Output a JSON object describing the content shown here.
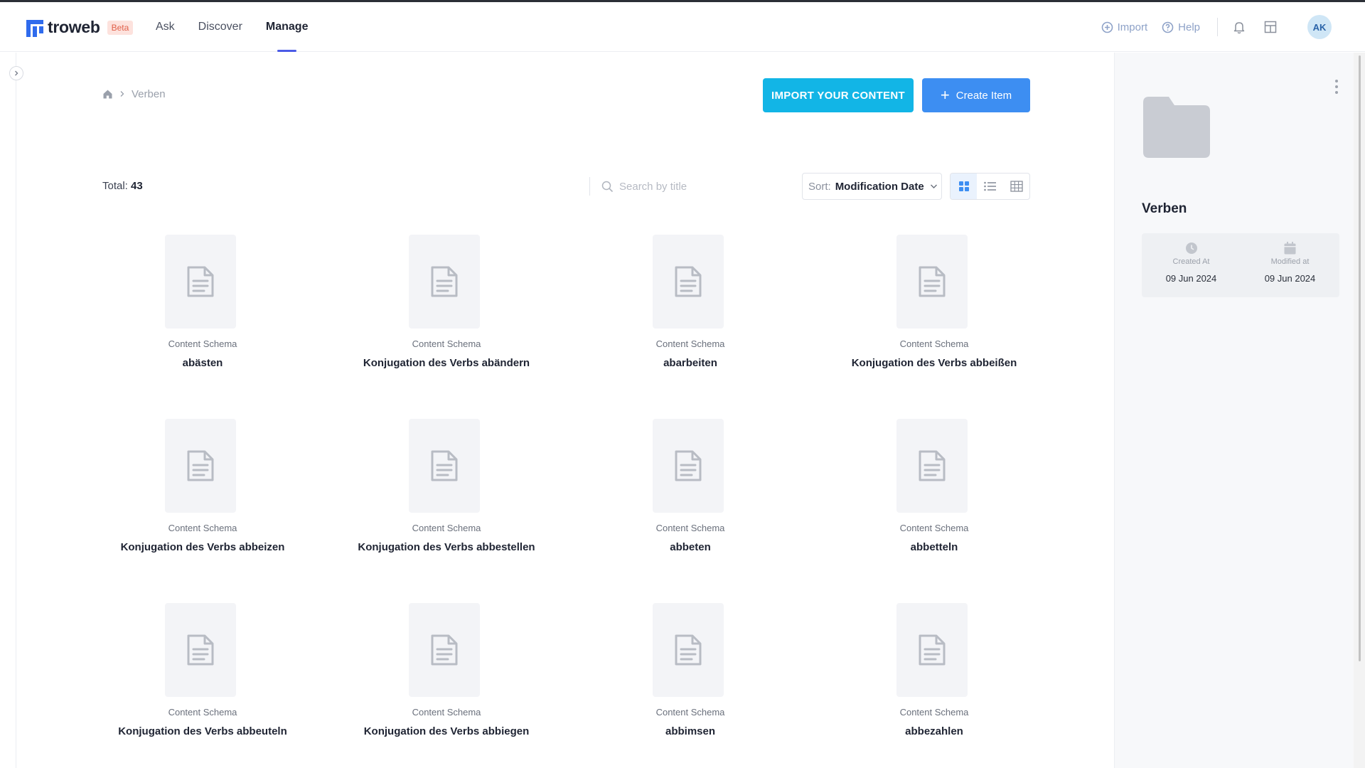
{
  "app": {
    "logo_text": "troweb",
    "badge": "Beta"
  },
  "nav": {
    "items": [
      {
        "label": "Ask"
      },
      {
        "label": "Discover"
      },
      {
        "label": "Manage",
        "active": true
      }
    ]
  },
  "header": {
    "import_label": "Import",
    "help_label": "Help",
    "avatar_initials": "AK",
    "icons": [
      "import-icon",
      "help-icon",
      "bell-icon",
      "layout-icon"
    ]
  },
  "breadcrumb": {
    "home_icon": "home-icon",
    "current": "Verben"
  },
  "actions": {
    "import_content": "IMPORT YOUR CONTENT",
    "create_item": "Create Item"
  },
  "toolbar": {
    "total_label": "Total:",
    "total_value": "43",
    "search_placeholder": "Search by title",
    "sort_label": "Sort:",
    "sort_value": "Modification Date",
    "active_view": "grid"
  },
  "items": [
    {
      "type": "Content Schema",
      "title": "abästen"
    },
    {
      "type": "Content Schema",
      "title": "Konjugation des Verbs abändern"
    },
    {
      "type": "Content Schema",
      "title": "abarbeiten"
    },
    {
      "type": "Content Schema",
      "title": "Konjugation des Verbs abbeißen"
    },
    {
      "type": "Content Schema",
      "title": "Konjugation des Verbs abbeizen"
    },
    {
      "type": "Content Schema",
      "title": "Konjugation des Verbs abbestellen"
    },
    {
      "type": "Content Schema",
      "title": "abbeten"
    },
    {
      "type": "Content Schema",
      "title": "abbetteln"
    },
    {
      "type": "Content Schema",
      "title": "Konjugation des Verbs abbeuteln"
    },
    {
      "type": "Content Schema",
      "title": "Konjugation des Verbs abbiegen"
    },
    {
      "type": "Content Schema",
      "title": "abbimsen"
    },
    {
      "type": "Content Schema",
      "title": "abbezahlen"
    }
  ],
  "panel": {
    "title": "Verben",
    "created_label": "Created At",
    "created_value": "09 Jun 2024",
    "modified_label": "Modified at",
    "modified_value": "09 Jun 2024"
  },
  "colors": {
    "accent": "#4b5be6",
    "import_button": "#12b5e6",
    "create_button": "#3d8ef2"
  }
}
